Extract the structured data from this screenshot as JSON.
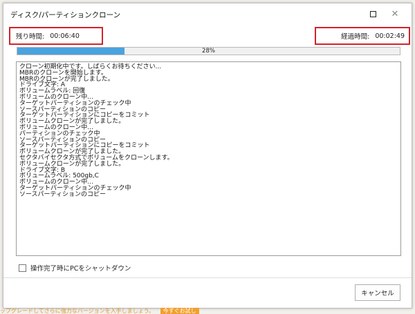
{
  "window": {
    "title": "ディスク/パーティションクローン"
  },
  "status": {
    "remaining_label": "残り時間:",
    "remaining_value": "00:06:40",
    "elapsed_label": "経過時間:",
    "elapsed_value": "00:02:49"
  },
  "progress": {
    "percent": 28,
    "label": "28%",
    "color": "#4aa3df"
  },
  "log_lines": [
    "クローン初期化中です。しばらくお待ちください...",
    "MBRのクローンを開始します。",
    "MBRのクローンが完了しました。",
    "ドライブ文字: A",
    "ボリュームラベル: 回復",
    "ボリュームのクローン中...",
    "ターゲットパーティションのチェック中",
    "ソースパーティションのコピー",
    "ターゲットパーティションにコピーをコミット",
    "ボリュームクローンが完了しました。",
    "ボリュームのクローン中...",
    "パーティションのチェック中",
    "ソースパーティションのコピー",
    "ターゲットパーティションにコピーをコミット",
    "ボリュームクローンが完了しました。",
    "セクタバイセクタ方式でボリュームをクローンします。",
    "ボリュームクローンが完了しました。",
    "ドライブ文字: B",
    "ボリュームラベル: 500gb,C",
    "ボリュームのクローン中...",
    "ターゲットパーティションのチェック中",
    "ソースパーティションのコピー"
  ],
  "options": {
    "shutdown_label": "操作完了時にPCをシャットダウン"
  },
  "buttons": {
    "cancel_label": "キャンセル"
  },
  "banner": {
    "text": "ップグレードしてさらに強力なバージョンを入手しましょう。",
    "button": "今すぐお試し"
  }
}
